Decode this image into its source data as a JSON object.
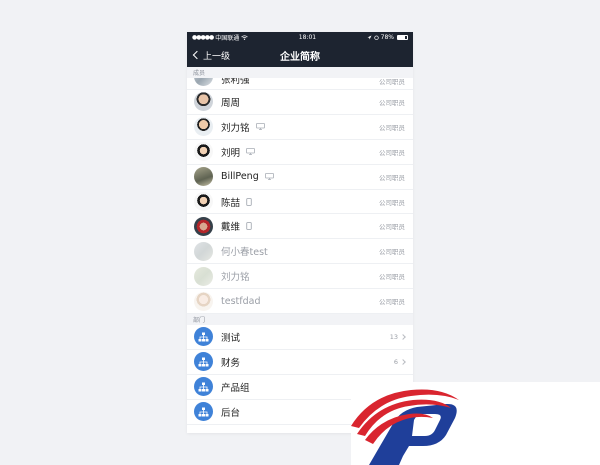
{
  "status_bar": {
    "carrier": "中国联通",
    "time": "18:01",
    "battery": "78%",
    "battery_level": 0.78
  },
  "nav": {
    "back_label": "上一级",
    "title": "企业简称"
  },
  "members": {
    "header": "成员",
    "items": [
      {
        "name": "张利强",
        "role": "公司职员",
        "device": "",
        "active": true
      },
      {
        "name": "周周",
        "role": "公司职员",
        "device": "",
        "active": true
      },
      {
        "name": "刘力铭",
        "role": "公司职员",
        "device": "desktop-icon",
        "active": true
      },
      {
        "name": "刘明",
        "role": "公司职员",
        "device": "desktop-icon",
        "active": true
      },
      {
        "name": "BillPeng",
        "role": "公司职员",
        "device": "desktop-icon",
        "active": true
      },
      {
        "name": "陈喆",
        "role": "公司职员",
        "device": "mobile-icon",
        "active": true
      },
      {
        "name": "戴维",
        "role": "公司职员",
        "device": "mobile-icon",
        "active": true
      },
      {
        "name": "何小春test",
        "role": "公司职员",
        "device": "",
        "active": false
      },
      {
        "name": "刘力铭",
        "role": "公司职员",
        "device": "",
        "active": false
      },
      {
        "name": "testfdad",
        "role": "公司职员",
        "device": "",
        "active": false
      }
    ]
  },
  "departments": {
    "header": "部门",
    "items": [
      {
        "name": "测试",
        "count": "13",
        "icon": "org-chart-icon"
      },
      {
        "name": "财务",
        "count": "6",
        "icon": "org-chart-icon"
      },
      {
        "name": "产品组",
        "count": "",
        "icon": "org-chart-icon"
      },
      {
        "name": "后台",
        "count": "",
        "icon": "org-chart-icon"
      }
    ]
  },
  "colors": {
    "nav_bg": "#1d2430",
    "dept_icon": "#3f82d8",
    "logo_red": "#d9252f",
    "logo_blue": "#1f3f9a"
  }
}
